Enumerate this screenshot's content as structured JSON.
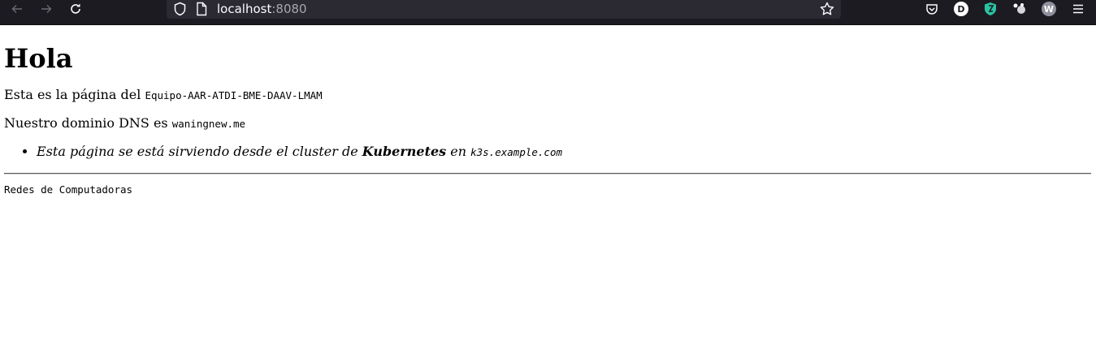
{
  "browser": {
    "url_host": "localhost",
    "url_port": ":8080",
    "profile_initial": "D",
    "account_initial": "W"
  },
  "page": {
    "heading": "Hola",
    "line1_text": "Esta es la página del ",
    "line1_code": "Equipo-AAR-ATDI-BME-DAAV-LMAM",
    "line2_text": "Nuestro dominio DNS es ",
    "line2_code": "waningnew.me",
    "bullet_prefix": "Esta página se está sirviendo desde el cluster de ",
    "bullet_bold": "Kubernetes",
    "bullet_mid": " en ",
    "bullet_code": "k3s.example.com",
    "footer": "Redes de Computadoras"
  }
}
